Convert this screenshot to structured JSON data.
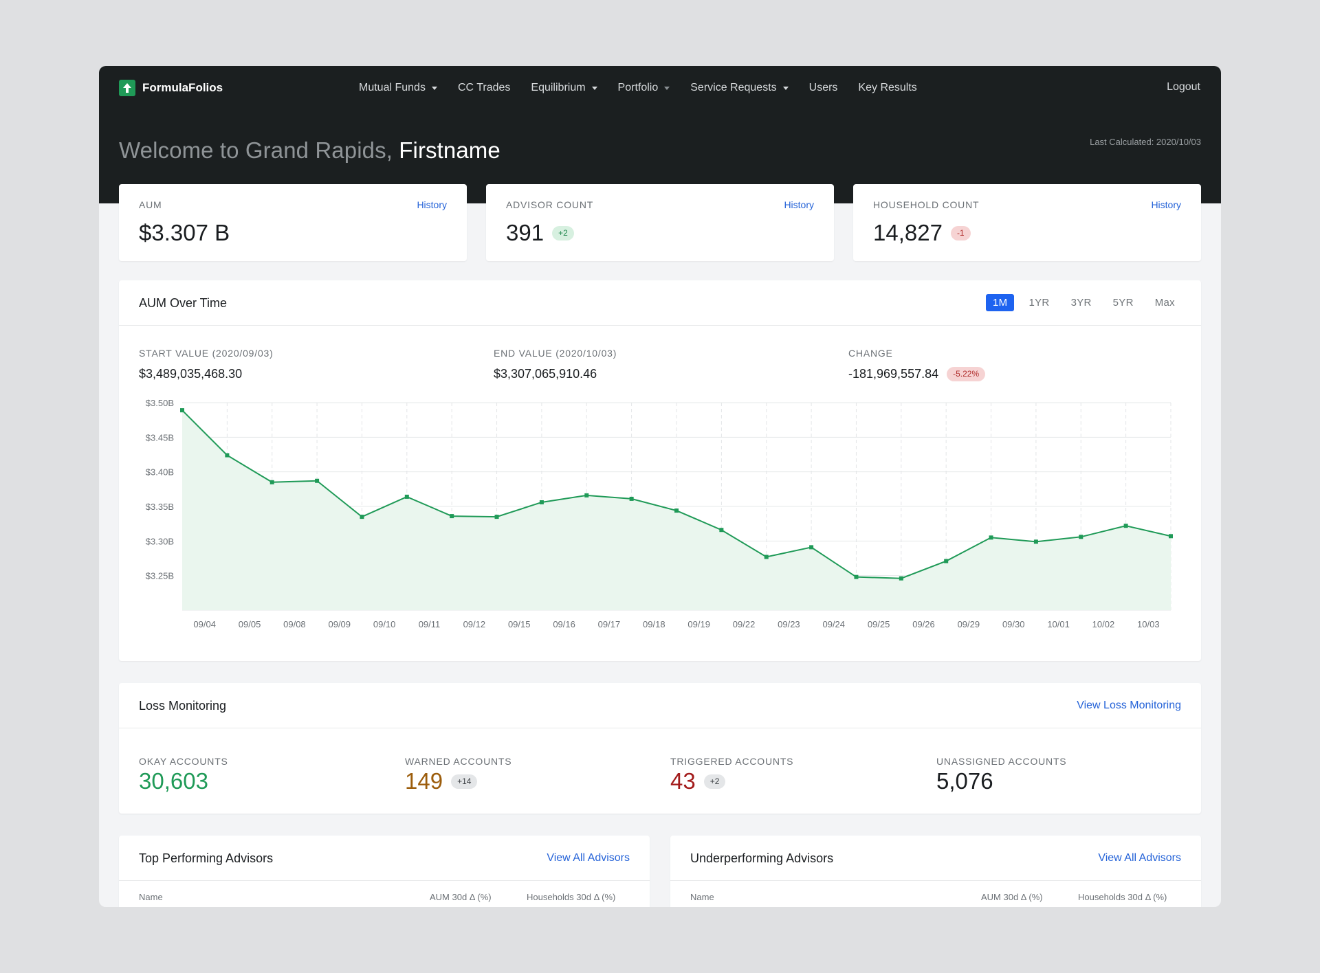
{
  "app": {
    "name": "FormulaFolios",
    "logo_icon": "up-arrow-icon"
  },
  "nav": {
    "items": [
      {
        "label": "Mutual Funds",
        "has_menu": true
      },
      {
        "label": "CC Trades",
        "has_menu": false
      },
      {
        "label": "Equilibrium",
        "has_menu": true
      },
      {
        "label": "Portfolio",
        "has_menu": true
      },
      {
        "label": "Service Requests",
        "has_menu": true
      },
      {
        "label": "Users",
        "has_menu": false
      },
      {
        "label": "Key Results",
        "has_menu": false
      }
    ],
    "logout": "Logout"
  },
  "header": {
    "welcome_prefix": "Welcome to Grand Rapids,",
    "user_name": "Firstname",
    "last_calculated": "Last Calculated: 2020/10/03"
  },
  "stats": [
    {
      "label": "AUM",
      "value": "$3.307 B",
      "link": "History",
      "badge": null
    },
    {
      "label": "ADVISOR COUNT",
      "value": "391",
      "link": "History",
      "badge": "+2",
      "badge_tone": "green"
    },
    {
      "label": "HOUSEHOLD COUNT",
      "value": "14,827",
      "link": "History",
      "badge": "-1",
      "badge_tone": "red"
    }
  ],
  "aum_chart": {
    "title": "AUM Over Time",
    "ranges": [
      "1M",
      "1YR",
      "3YR",
      "5YR",
      "Max"
    ],
    "active_range": "1M",
    "start_label": "START VALUE (2020/09/03)",
    "start_value": "$3,489,035,468.30",
    "end_label": "END VALUE (2020/10/03)",
    "end_value": "$3,307,065,910.46",
    "change_label": "CHANGE",
    "change_value": "-181,969,557.84",
    "change_pct": "-5.22%"
  },
  "chart_data": {
    "type": "area",
    "title": "AUM Over Time",
    "xlabel": "",
    "ylabel": "",
    "x": [
      "09/03",
      "09/04",
      "09/05",
      "09/08",
      "09/09",
      "09/10",
      "09/11",
      "09/12",
      "09/15",
      "09/16",
      "09/17",
      "09/18",
      "09/19",
      "09/22",
      "09/23",
      "09/24",
      "09/25",
      "09/26",
      "09/29",
      "09/30",
      "10/01",
      "10/02",
      "10/03"
    ],
    "x_tick_labels": [
      "09/04",
      "09/05",
      "09/08",
      "09/09",
      "09/10",
      "09/11",
      "09/12",
      "09/15",
      "09/16",
      "09/17",
      "09/18",
      "09/19",
      "09/22",
      "09/23",
      "09/24",
      "09/25",
      "09/26",
      "09/29",
      "09/30",
      "10/01",
      "10/02",
      "10/03"
    ],
    "series": [
      {
        "values": [
          3.489,
          3.424,
          3.385,
          3.387,
          3.335,
          3.364,
          3.336,
          3.335,
          3.356,
          3.366,
          3.361,
          3.344,
          3.316,
          3.277,
          3.291,
          3.248,
          3.246,
          3.271,
          3.305,
          3.299,
          3.306,
          3.322,
          3.307
        ],
        "color": "#1f9a57"
      }
    ],
    "y_ticks": [
      "$3.50B",
      "$3.45B",
      "$3.40B",
      "$3.35B",
      "$3.30B",
      "$3.25B"
    ],
    "y_tick_values": [
      3.5,
      3.45,
      3.4,
      3.35,
      3.3,
      3.25
    ],
    "ylim": [
      3.2,
      3.5
    ],
    "grid": true,
    "fill_color": "#eaf6ee"
  },
  "loss_monitoring": {
    "title": "Loss Monitoring",
    "link": "View Loss Monitoring",
    "items": [
      {
        "label": "OKAY ACCOUNTS",
        "value": "30,603",
        "color": "#1f9a57",
        "badge": null
      },
      {
        "label": "WARNED ACCOUNTS",
        "value": "149",
        "color": "#9c5d0c",
        "badge": "+14"
      },
      {
        "label": "TRIGGERED ACCOUNTS",
        "value": "43",
        "color": "#a31c1c",
        "badge": "+2"
      },
      {
        "label": "UNASSIGNED ACCOUNTS",
        "value": "5,076",
        "color": "#1a1d20",
        "badge": null
      }
    ]
  },
  "top_advisors": {
    "title": "Top Performing Advisors",
    "link": "View All Advisors",
    "columns": [
      "Name",
      "AUM 30d Δ (%)",
      "Households 30d Δ (%)"
    ]
  },
  "under_advisors": {
    "title": "Underperforming Advisors",
    "link": "View All Advisors",
    "columns": [
      "Name",
      "AUM 30d Δ (%)",
      "Households 30d Δ (%)"
    ]
  }
}
